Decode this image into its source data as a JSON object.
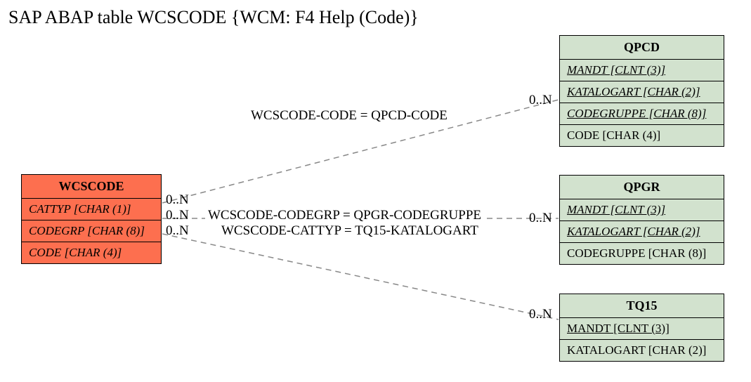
{
  "title": "SAP ABAP table WCSCODE {WCM: F4 Help (Code)}",
  "entities": {
    "wcscode": {
      "name": "WCSCODE",
      "fields": [
        "CATTYP [CHAR (1)]",
        "CODEGRP [CHAR (8)]",
        "CODE [CHAR (4)]"
      ]
    },
    "qpcd": {
      "name": "QPCD",
      "fields": [
        "MANDT [CLNT (3)]",
        "KATALOGART [CHAR (2)]",
        "CODEGRUPPE [CHAR (8)]",
        "CODE [CHAR (4)]"
      ]
    },
    "qpgr": {
      "name": "QPGR",
      "fields": [
        "MANDT [CLNT (3)]",
        "KATALOGART [CHAR (2)]",
        "CODEGRUPPE [CHAR (8)]"
      ]
    },
    "tq15": {
      "name": "TQ15",
      "fields": [
        "MANDT [CLNT (3)]",
        "KATALOGART [CHAR (2)]"
      ]
    }
  },
  "relations": {
    "r1": {
      "text": "WCSCODE-CODE = QPCD-CODE",
      "left_card": "0..N",
      "right_card": "0..N"
    },
    "r2": {
      "text": "WCSCODE-CODEGRP = QPGR-CODEGRUPPE",
      "left_card": "0..N",
      "right_card": "0..N"
    },
    "r3": {
      "text": "WCSCODE-CATTYP = TQ15-KATALOGART",
      "left_card": "0..N",
      "right_card": "0..N"
    }
  },
  "chart_data": {
    "type": "table",
    "description": "Entity-relationship diagram",
    "main_entity": "WCSCODE",
    "main_fields": [
      {
        "name": "CATTYP",
        "type": "CHAR",
        "len": 1
      },
      {
        "name": "CODEGRP",
        "type": "CHAR",
        "len": 8
      },
      {
        "name": "CODE",
        "type": "CHAR",
        "len": 4
      }
    ],
    "related_entities": [
      {
        "name": "QPCD",
        "fields": [
          {
            "name": "MANDT",
            "type": "CLNT",
            "len": 3
          },
          {
            "name": "KATALOGART",
            "type": "CHAR",
            "len": 2
          },
          {
            "name": "CODEGRUPPE",
            "type": "CHAR",
            "len": 8
          },
          {
            "name": "CODE",
            "type": "CHAR",
            "len": 4
          }
        ],
        "join": "WCSCODE-CODE = QPCD-CODE",
        "card_left": "0..N",
        "card_right": "0..N"
      },
      {
        "name": "QPGR",
        "fields": [
          {
            "name": "MANDT",
            "type": "CLNT",
            "len": 3
          },
          {
            "name": "KATALOGART",
            "type": "CHAR",
            "len": 2
          },
          {
            "name": "CODEGRUPPE",
            "type": "CHAR",
            "len": 8
          }
        ],
        "join": "WCSCODE-CODEGRP = QPGR-CODEGRUPPE",
        "card_left": "0..N",
        "card_right": "0..N"
      },
      {
        "name": "TQ15",
        "fields": [
          {
            "name": "MANDT",
            "type": "CLNT",
            "len": 3
          },
          {
            "name": "KATALOGART",
            "type": "CHAR",
            "len": 2
          }
        ],
        "join": "WCSCODE-CATTYP = TQ15-KATALOGART",
        "card_left": "0..N",
        "card_right": "0..N"
      }
    ]
  }
}
